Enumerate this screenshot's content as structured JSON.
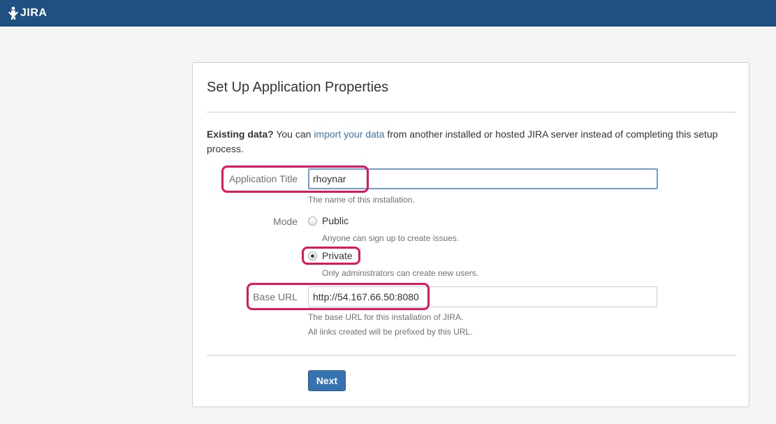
{
  "header": {
    "logo_text": "JIRA"
  },
  "panel": {
    "title": "Set Up Application Properties",
    "info": {
      "bold": "Existing data?",
      "text_before": " You can ",
      "link": "import your data",
      "text_after": " from another installed or hosted JIRA server instead of completing this setup process."
    },
    "app_title": {
      "label": "Application Title",
      "value": "rhoynar",
      "hint": "The name of this installation."
    },
    "mode": {
      "label": "Mode",
      "options": [
        {
          "label": "Public",
          "hint": "Anyone can sign up to create issues.",
          "checked": false
        },
        {
          "label": "Private",
          "hint": "Only administrators can create new users.",
          "checked": true
        }
      ]
    },
    "base_url": {
      "label": "Base URL",
      "value": "http://54.167.66.50:8080",
      "hint1": "The base URL for this installation of JIRA.",
      "hint2": "All links created will be prefixed by this URL."
    },
    "next_label": "Next"
  },
  "colors": {
    "header_bg": "#205081",
    "accent": "#3572b0",
    "link": "#3b73af",
    "annotation": "#e0175f"
  }
}
